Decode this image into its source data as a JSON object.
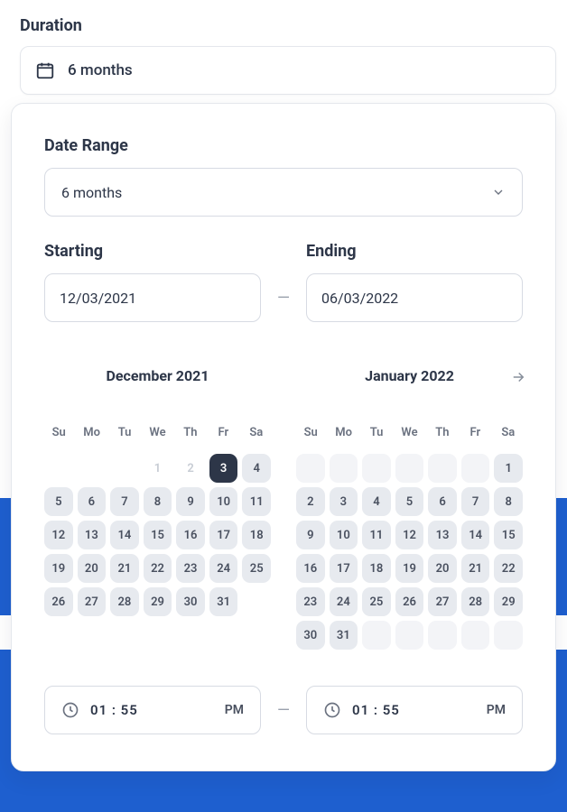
{
  "labels": {
    "duration": "Duration",
    "dateRange": "Date Range",
    "starting": "Starting",
    "ending": "Ending"
  },
  "duration": {
    "value": "6 months"
  },
  "rangeSelect": {
    "value": "6 months"
  },
  "starting": {
    "value": "12/03/2021"
  },
  "ending": {
    "value": "06/03/2022"
  },
  "separator": "—",
  "dow": [
    "Su",
    "Mo",
    "Tu",
    "We",
    "Th",
    "Fr",
    "Sa"
  ],
  "monthA": {
    "title": "December 2021",
    "leading": 3,
    "dimBefore": 3,
    "selected": 3,
    "days": 31
  },
  "monthB": {
    "title": "January 2022",
    "leadingGhost": 6,
    "days": 31
  },
  "time": {
    "value": "01 : 55",
    "period": "PM"
  }
}
